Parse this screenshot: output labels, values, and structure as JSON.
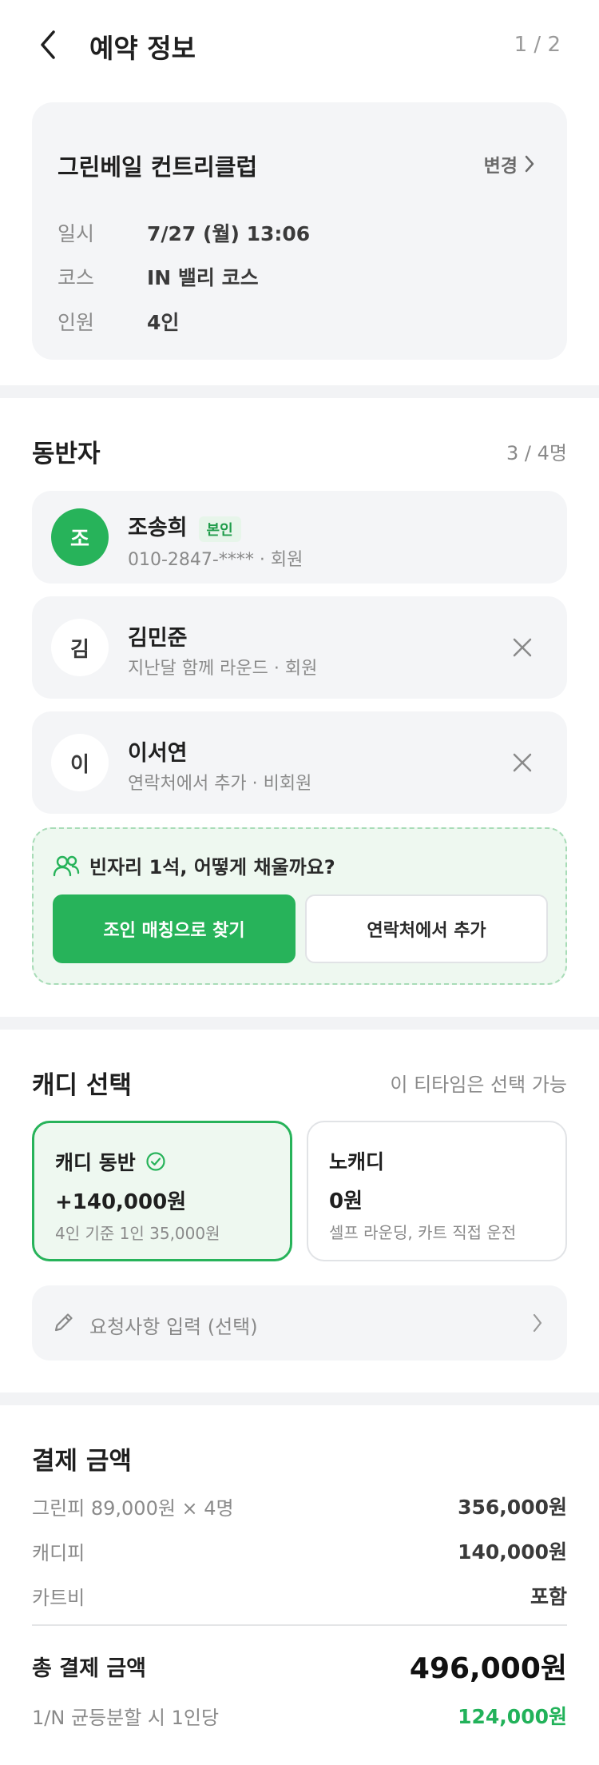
{
  "header": {
    "title": "예약 정보",
    "step": "1 / 2"
  },
  "reservation": {
    "club": "그린베일 컨트리클럽",
    "change_label": "변경",
    "rows": [
      {
        "label": "일시",
        "value": "7/27 (월) 13:06"
      },
      {
        "label": "코스",
        "value": "IN 밸리 코스"
      },
      {
        "label": "인원",
        "value": "4인"
      }
    ]
  },
  "companions": {
    "title": "동반자",
    "count": "3 / 4명",
    "list": [
      {
        "initial": "조",
        "name": "조송희",
        "badge": "본인",
        "sub": "010-2847-**** · 회원"
      },
      {
        "initial": "김",
        "name": "김민준",
        "sub": "지난달 함께 라운드 · 회원"
      },
      {
        "initial": "이",
        "name": "이서연",
        "sub": "연락처에서 추가 · 비회원"
      }
    ],
    "empty_seat": {
      "text": "빈자리 1석, 어떻게 채울까요?",
      "primary": "조인 매칭으로 찾기",
      "secondary": "연락처에서 추가"
    }
  },
  "caddie": {
    "title": "캐디 선택",
    "note": "이 티타임은 선택 가능",
    "options": [
      {
        "name": "캐디 동반",
        "price": "+140,000원",
        "desc": "4인 기준 1인 35,000원",
        "selected": true
      },
      {
        "name": "노캐디",
        "price": "0원",
        "desc": "셀프 라운딩, 카트 직접 운전",
        "selected": false
      }
    ],
    "request_placeholder": "요청사항 입력 (선택)"
  },
  "payment": {
    "title": "결제 금액",
    "rows": [
      {
        "label": "그린피 89,000원 × 4명",
        "value": "356,000원"
      },
      {
        "label": "캐디피",
        "value": "140,000원"
      },
      {
        "label": "카트비",
        "value": "포함"
      }
    ],
    "total_label": "총 결제 금액",
    "total_value": "496,000원",
    "per_person_label": "1/N 균등분할 시 1인당",
    "per_person_value": "124,000원"
  },
  "colors": {
    "accent": "#27b35a",
    "accent_light": "#eef8f0",
    "card_bg": "#f4f5f7"
  }
}
